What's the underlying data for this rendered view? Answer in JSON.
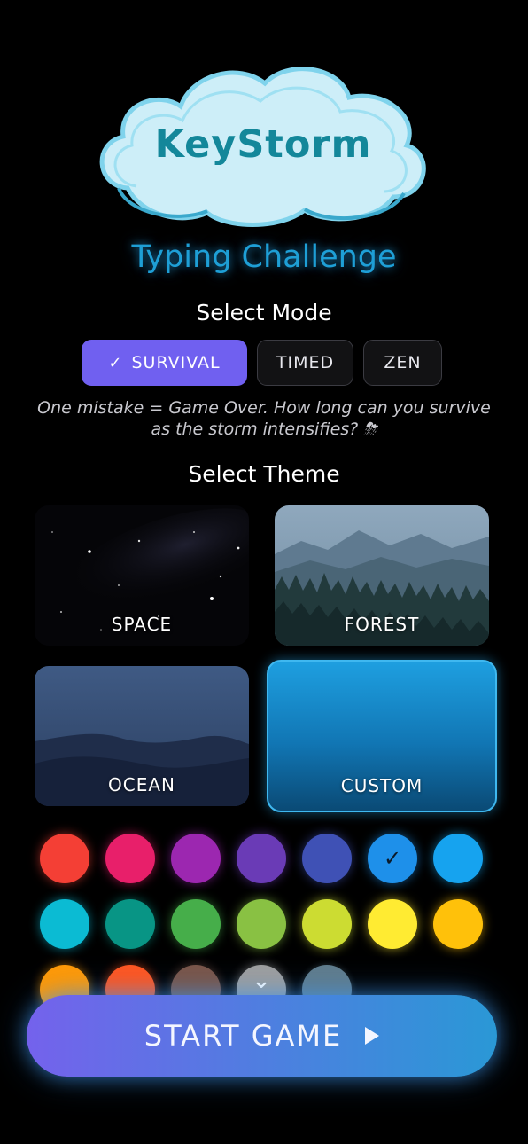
{
  "app": {
    "logo_text": "KeyStorm",
    "subtitle": "Typing Challenge"
  },
  "mode_section": {
    "title": "Select Mode",
    "modes": [
      {
        "label": "SURVIVAL",
        "selected": true
      },
      {
        "label": "TIMED",
        "selected": false
      },
      {
        "label": "ZEN",
        "selected": false
      }
    ],
    "description": "One mistake = Game Over. How long can you survive as the storm intensifies? ⛈"
  },
  "theme_section": {
    "title": "Select Theme",
    "themes": [
      {
        "label": "SPACE",
        "selected": false
      },
      {
        "label": "FOREST",
        "selected": false
      },
      {
        "label": "OCEAN",
        "selected": false
      },
      {
        "label": "CUSTOM",
        "selected": true
      }
    ]
  },
  "color_palette": {
    "selected_color": "#1e90ea",
    "colors": [
      "#f43f35",
      "#e81f6a",
      "#9c27b0",
      "#6a3bb6",
      "#3f51b5",
      "#1e90ea",
      "#16a3ef",
      "#0bbbd3",
      "#089585",
      "#46ae4a",
      "#89c143",
      "#ccdc32",
      "#ffeb32",
      "#ffc10a",
      "#ff9906",
      "#ff5620",
      "#7a5548",
      "#9e9e9e",
      "#607c8c"
    ]
  },
  "start_button": {
    "label": "START GAME"
  },
  "icons": {
    "check": "check-icon",
    "play": "play-icon",
    "chevron": "chevron-down-icon"
  }
}
